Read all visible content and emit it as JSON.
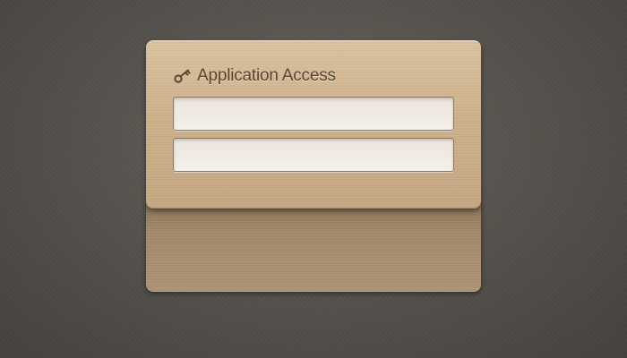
{
  "login_panel": {
    "title": "Application Access",
    "icon": "key-icon",
    "fields": [
      {
        "value": "",
        "placeholder": ""
      },
      {
        "value": "",
        "placeholder": ""
      }
    ]
  },
  "colors": {
    "background": "#57534e",
    "wood_light": "#dcc3a0",
    "wood_dark": "#a48a69",
    "title_text": "#5a4630",
    "field_bg": "#f4f0ea"
  }
}
